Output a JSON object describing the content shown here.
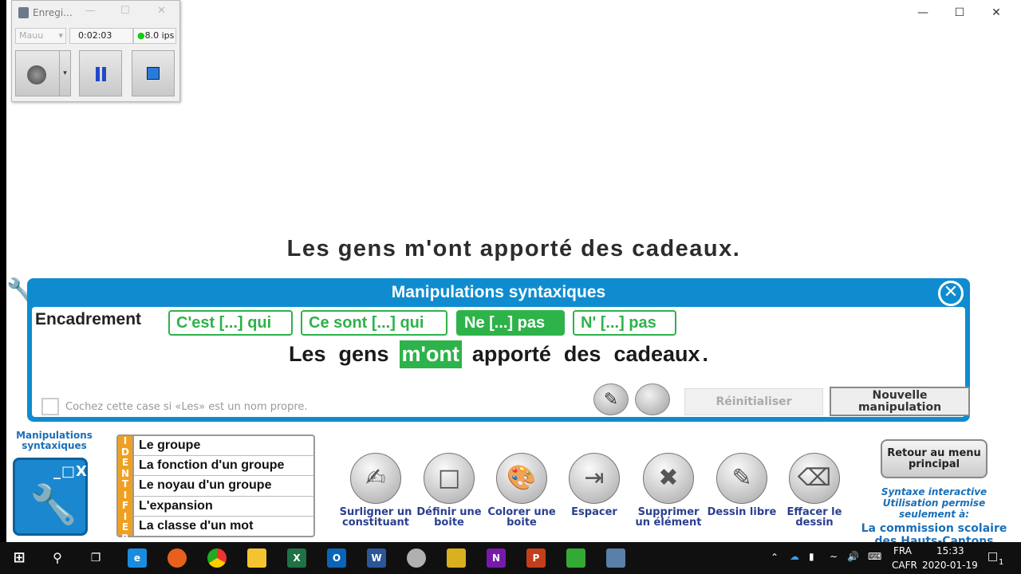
{
  "recorder": {
    "title": "Enregi...",
    "mode": "Mauu",
    "elapsed": "0:02:03",
    "fps": "8.0 ips"
  },
  "top_sentence": "Les gens m'ont apporté des cadeaux.",
  "dialog": {
    "title": "Manipulations syntaxiques",
    "encadrement_label": "Encadrement",
    "buttons": [
      {
        "label": "C'est [...] qui",
        "active": false
      },
      {
        "label": "Ce sont [...] qui",
        "active": false
      },
      {
        "label": "Ne [...] pas",
        "active": true
      },
      {
        "label": "N' [...] pas",
        "active": false
      }
    ],
    "sentence_words": [
      "Les",
      "gens",
      "m'ont",
      "apporté",
      "des",
      "cadeaux",
      "."
    ],
    "highlighted_word_index": 2,
    "checkbox_label": "Cochez cette case si «Les» est un nom propre.",
    "reset_label": "Réinitialiser",
    "new_label": "Nouvelle manipulation"
  },
  "sidebar": {
    "app_label": "Manipulations syntaxiques",
    "identify_letters": [
      "I",
      "D",
      "E",
      "N",
      "T",
      "I",
      "F",
      "I",
      "E",
      "R"
    ],
    "identify_items": [
      "Le groupe",
      "La fonction d'un groupe",
      "Le noyau d'un groupe",
      "L'expansion",
      "La classe d'un mot"
    ]
  },
  "tools": [
    {
      "icon": "highlighter-icon",
      "label": "Surligner un constituant"
    },
    {
      "icon": "box-icon",
      "label": "Définir une boite"
    },
    {
      "icon": "palette-icon",
      "label": "Colorer une boite"
    },
    {
      "icon": "space-arrow-icon",
      "label": "Espacer"
    },
    {
      "icon": "x-delete-icon",
      "label": "Supprimer un élément"
    },
    {
      "icon": "pencil-icon",
      "label": "Dessin libre"
    },
    {
      "icon": "eraser-icon",
      "label": "Effacer le dessin"
    }
  ],
  "back_button": "Retour au menu principal",
  "credit": {
    "line1": "Syntaxe interactive",
    "line2": "Utilisation permise seulement à:",
    "org": "La commission scolaire des Hauts-Cantons"
  },
  "taskbar": {
    "lang1": "FRA",
    "lang2": "CAFR",
    "time": "15:33",
    "date": "2020-01-19",
    "notif": "1"
  },
  "colors": {
    "dialog_blue": "#0f8ccf",
    "accent_green": "#2db34a",
    "identify_orange": "#f0a020"
  }
}
